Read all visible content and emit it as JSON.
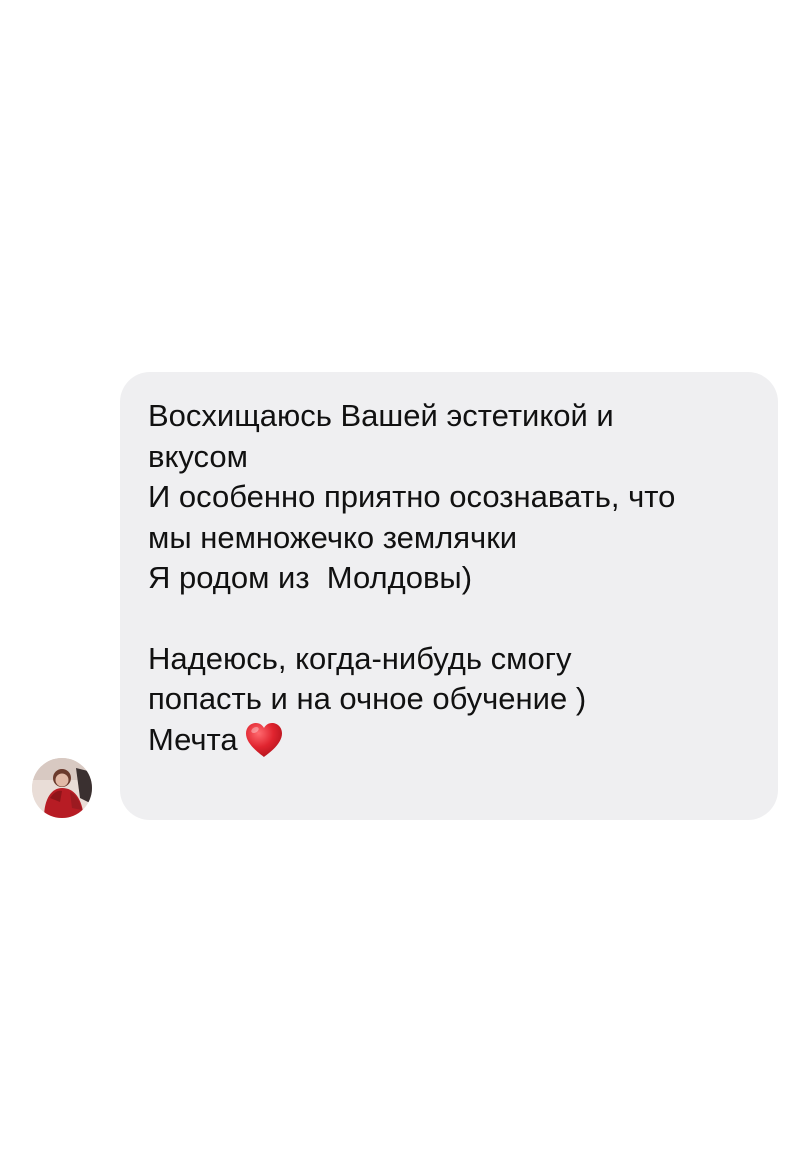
{
  "conversation": {
    "message": {
      "lines": [
        "Восхищаюсь Вашей эстетикой и",
        "вкусом",
        "И особенно приятно осознавать, что",
        "мы немножечко землячки",
        "Я родом из  Молдовы)",
        "",
        "Надеюсь, когда-нибудь смогу",
        "попасть и на очное обучение )",
        "Мечта"
      ],
      "trailing_emoji": "heart-icon"
    },
    "sender_avatar": "avatar",
    "colors": {
      "bubble_background": "#efeff1",
      "text": "#111111",
      "page_background": "#ffffff",
      "heart": "#e0242f"
    }
  }
}
